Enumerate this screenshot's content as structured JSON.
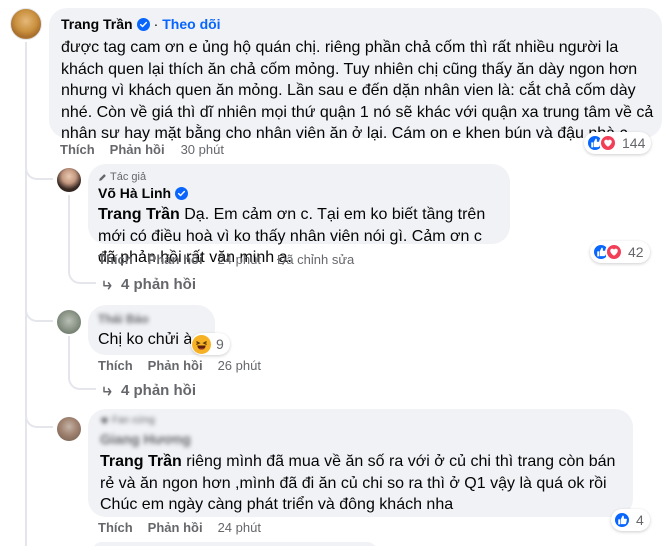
{
  "comment1": {
    "author": "Trang Trần",
    "follow": "Theo dõi",
    "text": "được tag cam ơn e ủng hộ quán chị. riêng phần chả cốm thì rất nhiều người la khách quen lại thích ăn chả cốm mỏng. Tuy nhiên chị cũng thấy ăn dày ngon hơn nhưng vì khách quen ăn mỏng. Lần sau e đến dặn nhân vien là: cắt chả cốm dày nhé. Còn về giá thì dĩ nhiên mọi thứ quận 1 nó sẽ khác với quận xa trung tâm về cả nhân sư hay mặt bằng cho nhân viên ăn ở lại. Cám on e khen bún và đậu nhà c .",
    "like": "Thích",
    "reply": "Phản hồi",
    "time": "30 phút",
    "reactions": "144"
  },
  "reply1": {
    "badge": "Tác giả",
    "author": "Võ Hà Linh",
    "mention": "Trang Trần",
    "text": " Dạ. Em cảm ơn c. Tại em ko biết tầng trên mới có điều hoà vì ko thấy nhân viên nói gì. Cảm ơn c đã phản hồi rất văn minh ạ.",
    "like": "Thích",
    "reply": "Phản hồi",
    "time": "24 phút",
    "edited": "Đã chỉnh sửa",
    "reactions": "42",
    "more": "4 phản hồi"
  },
  "reply2": {
    "author": "Thái Bảo",
    "text": "Chị ko chửi à",
    "like": "Thích",
    "reply": "Phản hồi",
    "time": "26 phút",
    "reactions": "9",
    "more": "4 phản hồi"
  },
  "reply3": {
    "badge": "Fan cứng",
    "author": "Giang Hương",
    "mention": "Trang Trần",
    "text": " riêng mình đã mua về ăn số ra với ở củ chi thì trang còn bán rẻ và ăn ngon hơn ,mình đã đi ăn củ chi so ra thì ở Q1 vậy là quá ok rồi Chúc em ngày càng phát triển và đông khách nha",
    "like": "Thích",
    "reply": "Phản hồi",
    "time": "24 phút",
    "reactions": "4"
  },
  "colors": {
    "bubble": "#f0f2f5",
    "link": "#0866ff",
    "secondary": "#65676b",
    "love": "#f33e58",
    "haha": "#f7b125"
  },
  "icons": [
    "verified-badge-icon",
    "like-reaction-icon",
    "love-reaction-icon",
    "haha-reaction-icon",
    "pencil-icon",
    "fan-badge-icon"
  ]
}
